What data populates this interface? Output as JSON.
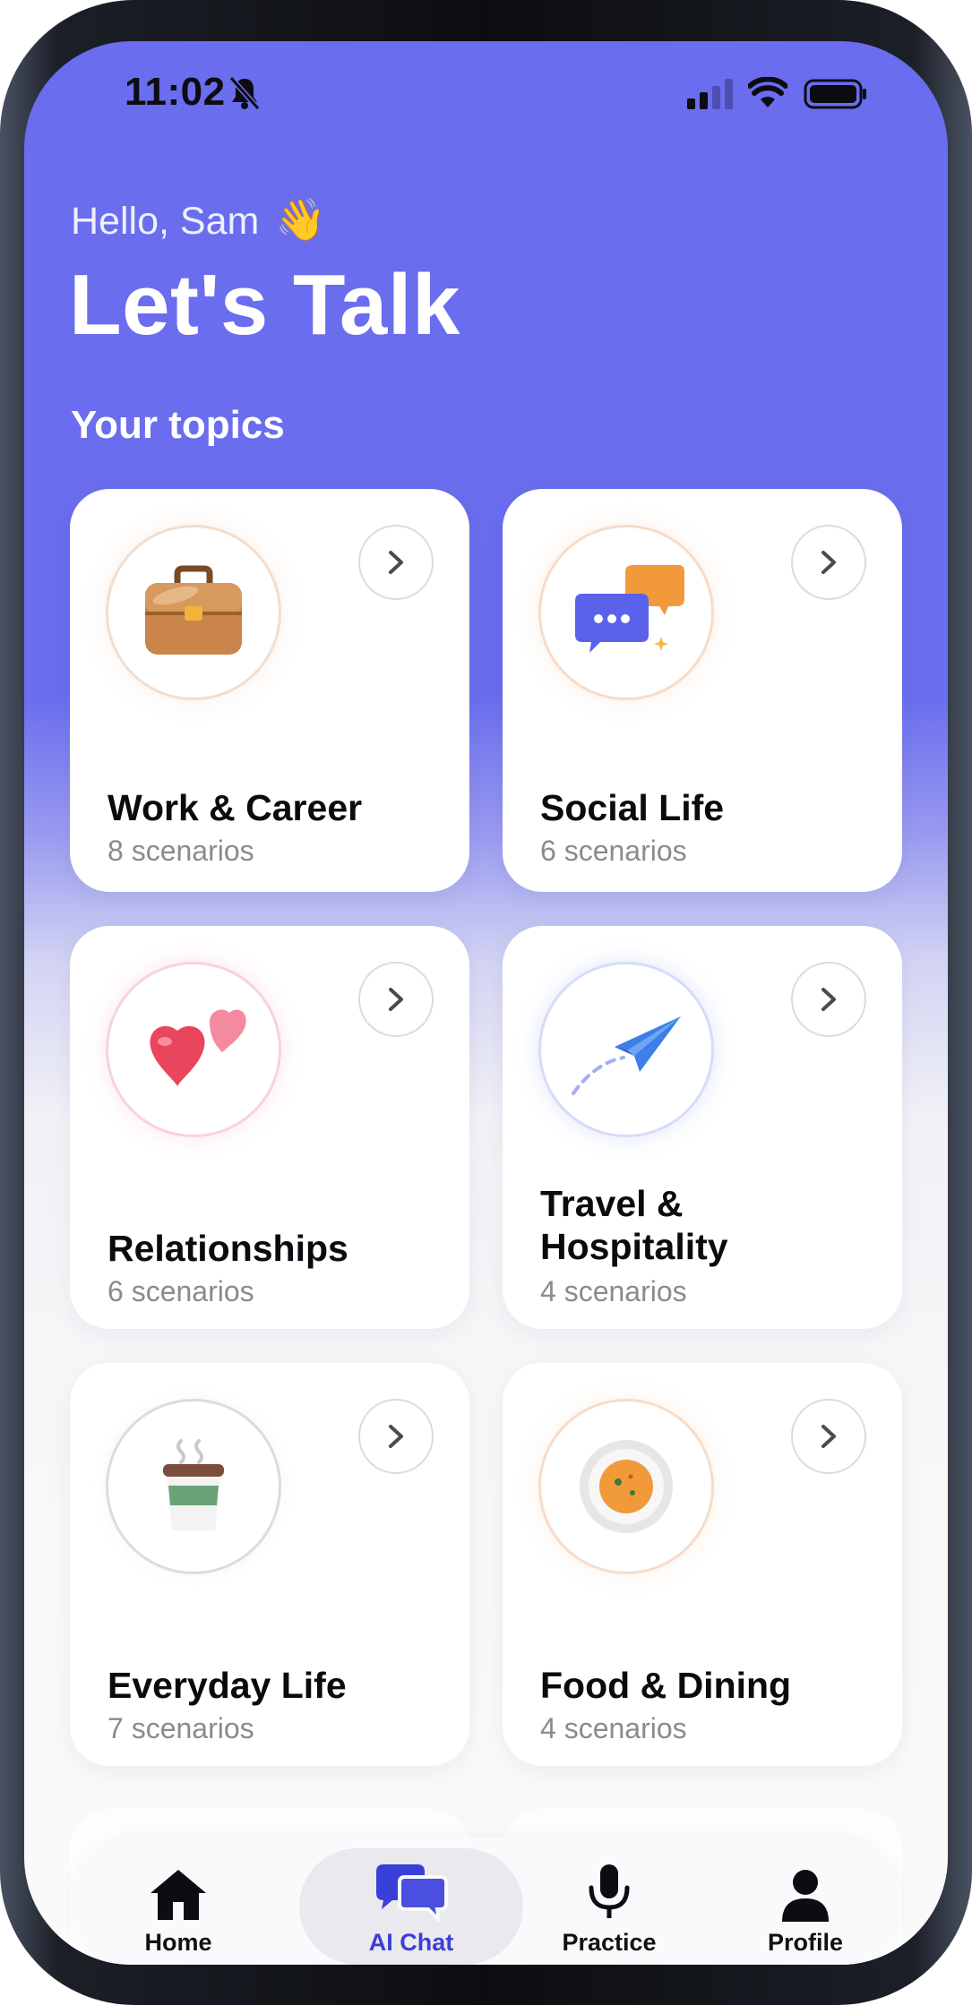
{
  "status_bar": {
    "time": "11:02"
  },
  "header": {
    "greeting": "Hello, Sam",
    "greeting_emoji": "👋",
    "title": "Let's Talk",
    "section_title": "Your topics"
  },
  "topics": [
    {
      "name": "Work & Career",
      "scenarios": "8 scenarios",
      "icon": "briefcase-icon"
    },
    {
      "name": "Social Life",
      "scenarios": "6 scenarios",
      "icon": "speech-bubbles-icon"
    },
    {
      "name": "Relationships",
      "scenarios": "6 scenarios",
      "icon": "hearts-icon"
    },
    {
      "name": "Travel & Hospitality",
      "scenarios": "4 scenarios",
      "icon": "paper-plane-icon"
    },
    {
      "name": "Everyday Life",
      "scenarios": "7 scenarios",
      "icon": "coffee-cup-icon"
    },
    {
      "name": "Food & Dining",
      "scenarios": "4 scenarios",
      "icon": "plate-icon"
    }
  ],
  "tabbar": {
    "items": [
      {
        "label": "Home",
        "icon": "home-icon"
      },
      {
        "label": "AI Chat",
        "icon": "chat-bubbles-icon",
        "active": true
      },
      {
        "label": "Practice",
        "icon": "microphone-icon"
      },
      {
        "label": "Profile",
        "icon": "person-icon"
      }
    ]
  },
  "colors": {
    "header_bg": "#6a6ded",
    "accent": "#4a4fe0",
    "card_bg": "#ffffff"
  }
}
